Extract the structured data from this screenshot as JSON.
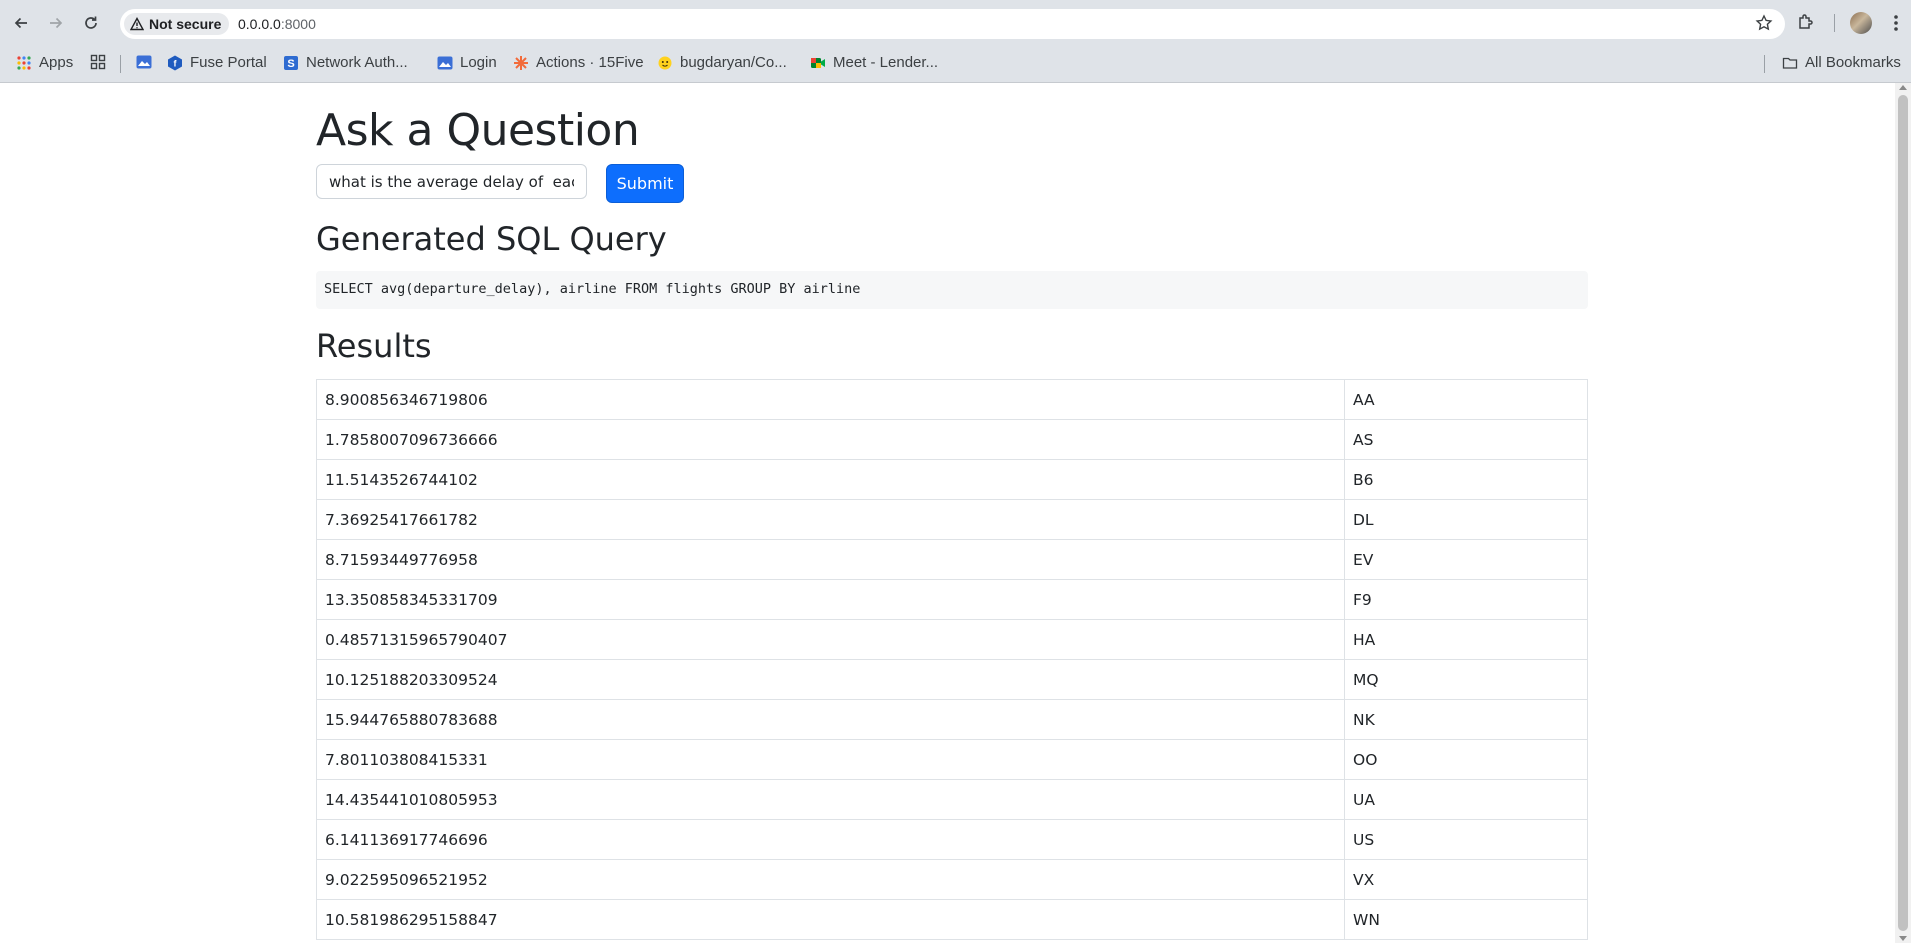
{
  "browser": {
    "security_label": "Not secure",
    "url_host": "0.0.0.0",
    "url_port": ":8000",
    "bookmarks": [
      {
        "label": "Apps",
        "icon": "apps-grid-icon"
      },
      {
        "label": "",
        "icon": "tab-groups-icon"
      },
      {
        "label": "",
        "icon": "image-icon"
      },
      {
        "label": "Fuse Portal",
        "icon": "fuse-icon"
      },
      {
        "label": "Network Auth...",
        "icon": "network-auth-icon"
      },
      {
        "label": "Login",
        "icon": "login-icon"
      },
      {
        "label": "Actions · 15Five",
        "icon": "15five-icon"
      },
      {
        "label": "bugdaryan/Co...",
        "icon": "hugging-face-icon"
      },
      {
        "label": "Meet - Lender...",
        "icon": "meet-icon"
      }
    ],
    "all_bookmarks_label": "All Bookmarks"
  },
  "page": {
    "title": "Ask a Question",
    "question_value": "what is the average delay of  each airline",
    "submit_label": "Submit",
    "sql_heading": "Generated SQL Query",
    "sql_query": "SELECT avg(departure_delay), airline FROM flights GROUP BY airline",
    "results_heading": "Results",
    "results": [
      [
        "8.900856346719806",
        "AA"
      ],
      [
        "1.7858007096736666",
        "AS"
      ],
      [
        "11.5143526744102",
        "B6"
      ],
      [
        "7.36925417661782",
        "DL"
      ],
      [
        "8.71593449776958",
        "EV"
      ],
      [
        "13.350858345331709",
        "F9"
      ],
      [
        "0.48571315965790407",
        "HA"
      ],
      [
        "10.125188203309524",
        "MQ"
      ],
      [
        "15.944765880783688",
        "NK"
      ],
      [
        "7.801103808415331",
        "OO"
      ],
      [
        "14.435441010805953",
        "UA"
      ],
      [
        "6.141136917746696",
        "US"
      ],
      [
        "9.022595096521952",
        "VX"
      ],
      [
        "10.581986295158847",
        "WN"
      ]
    ]
  },
  "colors": {
    "primary_button": "#0d6efd",
    "chrome_bg": "#dfe3e8"
  }
}
